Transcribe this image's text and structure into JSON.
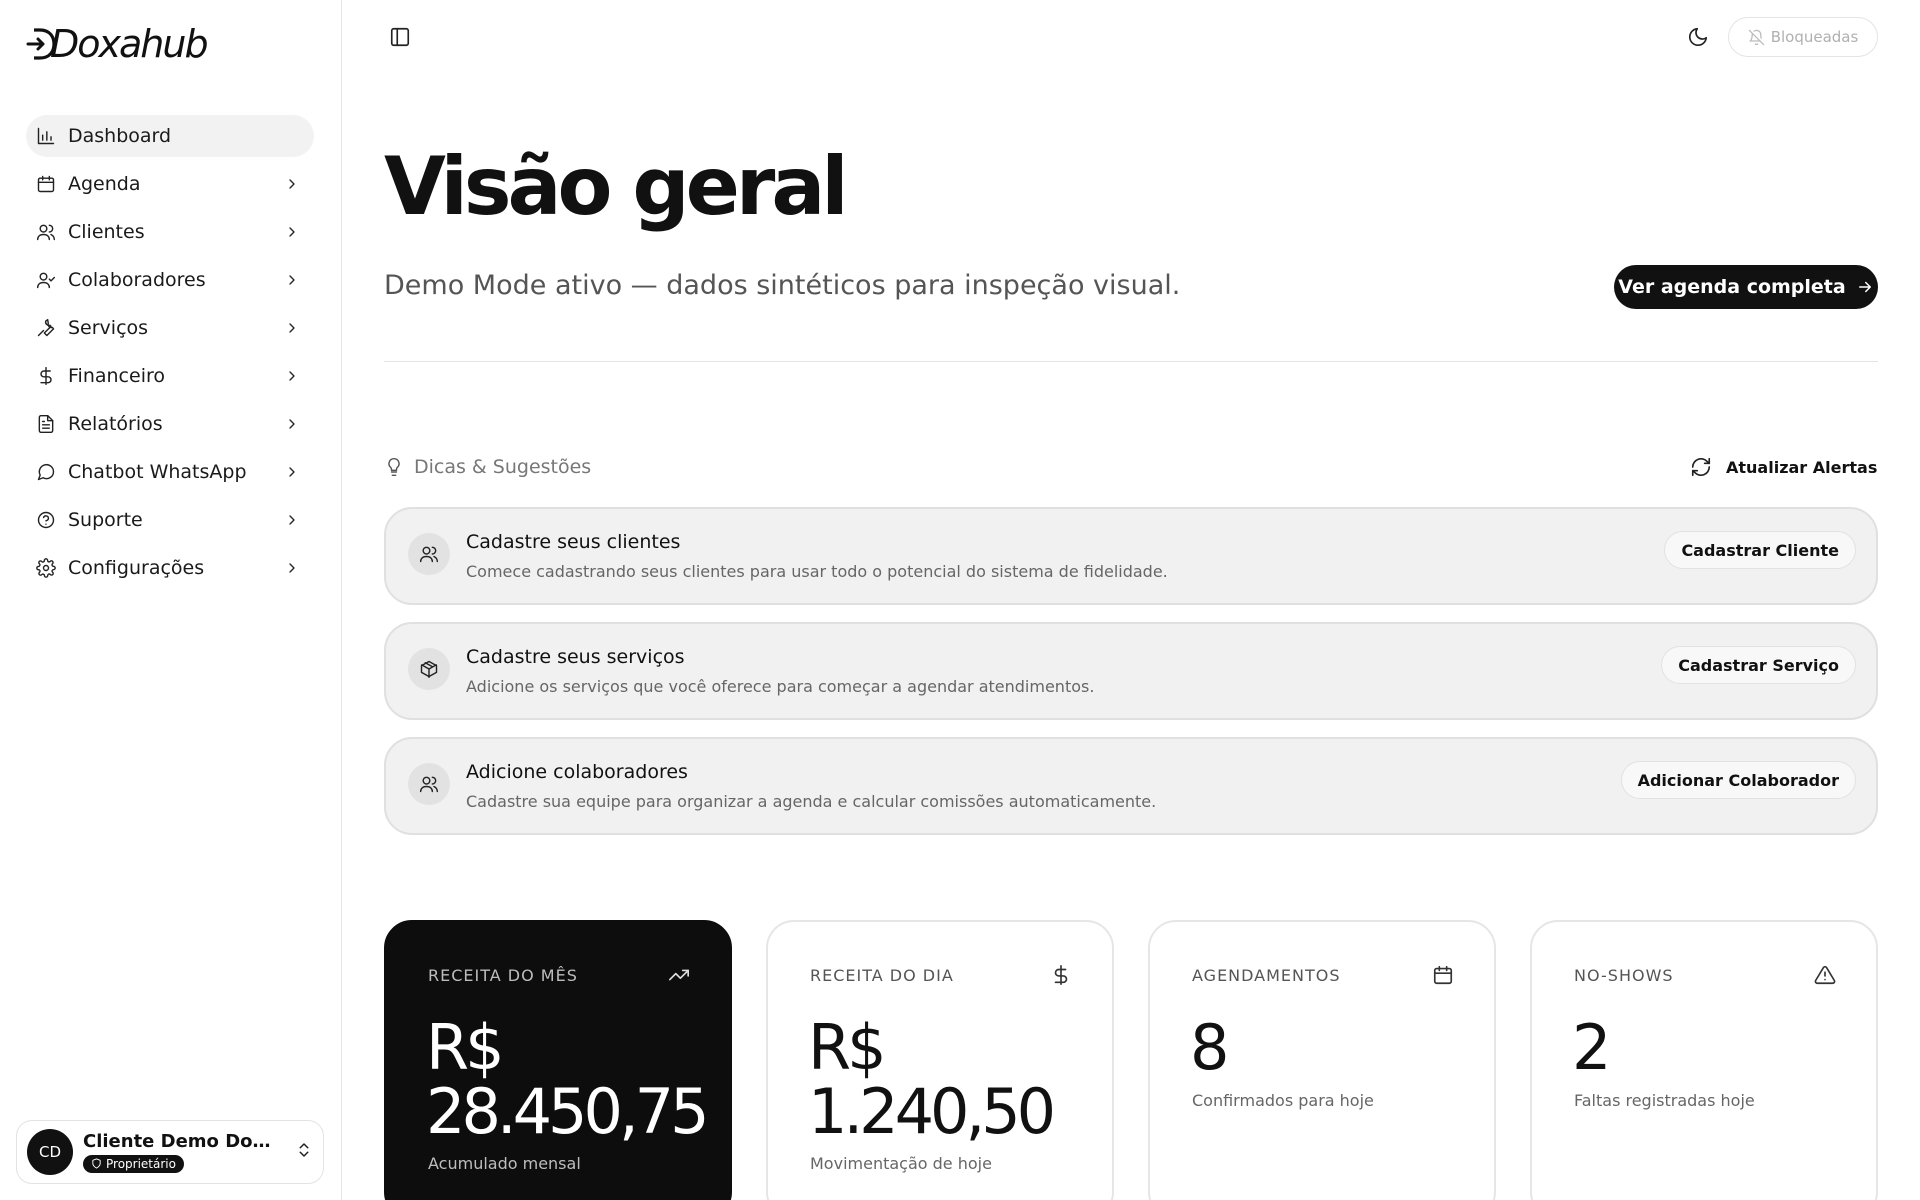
{
  "brand": {
    "name": "Doxahub"
  },
  "sidebar": {
    "items": [
      {
        "label": "Dashboard",
        "icon": "bar-chart-icon",
        "active": true,
        "has_chevron": false
      },
      {
        "label": "Agenda",
        "icon": "calendar-icon",
        "has_chevron": true
      },
      {
        "label": "Clientes",
        "icon": "users-icon",
        "has_chevron": true
      },
      {
        "label": "Colaboradores",
        "icon": "user-check-icon",
        "has_chevron": true
      },
      {
        "label": "Serviços",
        "icon": "wrench-icon",
        "has_chevron": true
      },
      {
        "label": "Financeiro",
        "icon": "dollar-icon",
        "has_chevron": true
      },
      {
        "label": "Relatórios",
        "icon": "file-text-icon",
        "has_chevron": true
      },
      {
        "label": "Chatbot WhatsApp",
        "icon": "message-circle-icon",
        "has_chevron": true
      },
      {
        "label": "Suporte",
        "icon": "help-circle-icon",
        "has_chevron": true
      },
      {
        "label": "Configurações",
        "icon": "settings-icon",
        "has_chevron": true
      }
    ],
    "user": {
      "initials": "CD",
      "name": "Cliente Demo Doxa...",
      "role": "Proprietário"
    }
  },
  "header": {
    "notifications_label": "Bloqueadas"
  },
  "main": {
    "title": "Visão geral",
    "subtitle": "Demo Mode ativo — dados sintéticos para inspeção visual.",
    "cta_label": "Ver agenda completa",
    "tips": {
      "title": "Dicas & Sugestões",
      "refresh_label": "Atualizar Alertas",
      "cards": [
        {
          "title": "Cadastre seus clientes",
          "description": "Comece cadastrando seus clientes para usar todo o potencial do sistema de fidelidade.",
          "action": "Cadastrar Cliente",
          "icon": "users-icon"
        },
        {
          "title": "Cadastre seus serviços",
          "description": "Adicione os serviços que você oferece para começar a agendar atendimentos.",
          "action": "Cadastrar Serviço",
          "icon": "package-icon"
        },
        {
          "title": "Adicione colaboradores",
          "description": "Cadastre sua equipe para organizar a agenda e calcular comissões automaticamente.",
          "action": "Adicionar Colaborador",
          "icon": "users-icon"
        }
      ]
    },
    "kpis": [
      {
        "label": "RECEITA DO MÊS",
        "value_line1": "R$",
        "value_line2": "28.450,75",
        "caption": "Acumulado mensal",
        "icon": "trending-up-icon",
        "dark": true
      },
      {
        "label": "RECEITA DO DIA",
        "value_line1": "R$",
        "value_line2": "1.240,50",
        "caption": "Movimentação de hoje",
        "icon": "dollar-icon",
        "dark": false
      },
      {
        "label": "AGENDAMENTOS",
        "value_line1": "8",
        "value_line2": "",
        "caption": "Confirmados para hoje",
        "icon": "calendar-icon",
        "dark": false
      },
      {
        "label": "NO-SHOWS",
        "value_line1": "2",
        "value_line2": "",
        "caption": "Faltas registradas hoje",
        "icon": "alert-triangle-icon",
        "dark": false
      }
    ]
  }
}
